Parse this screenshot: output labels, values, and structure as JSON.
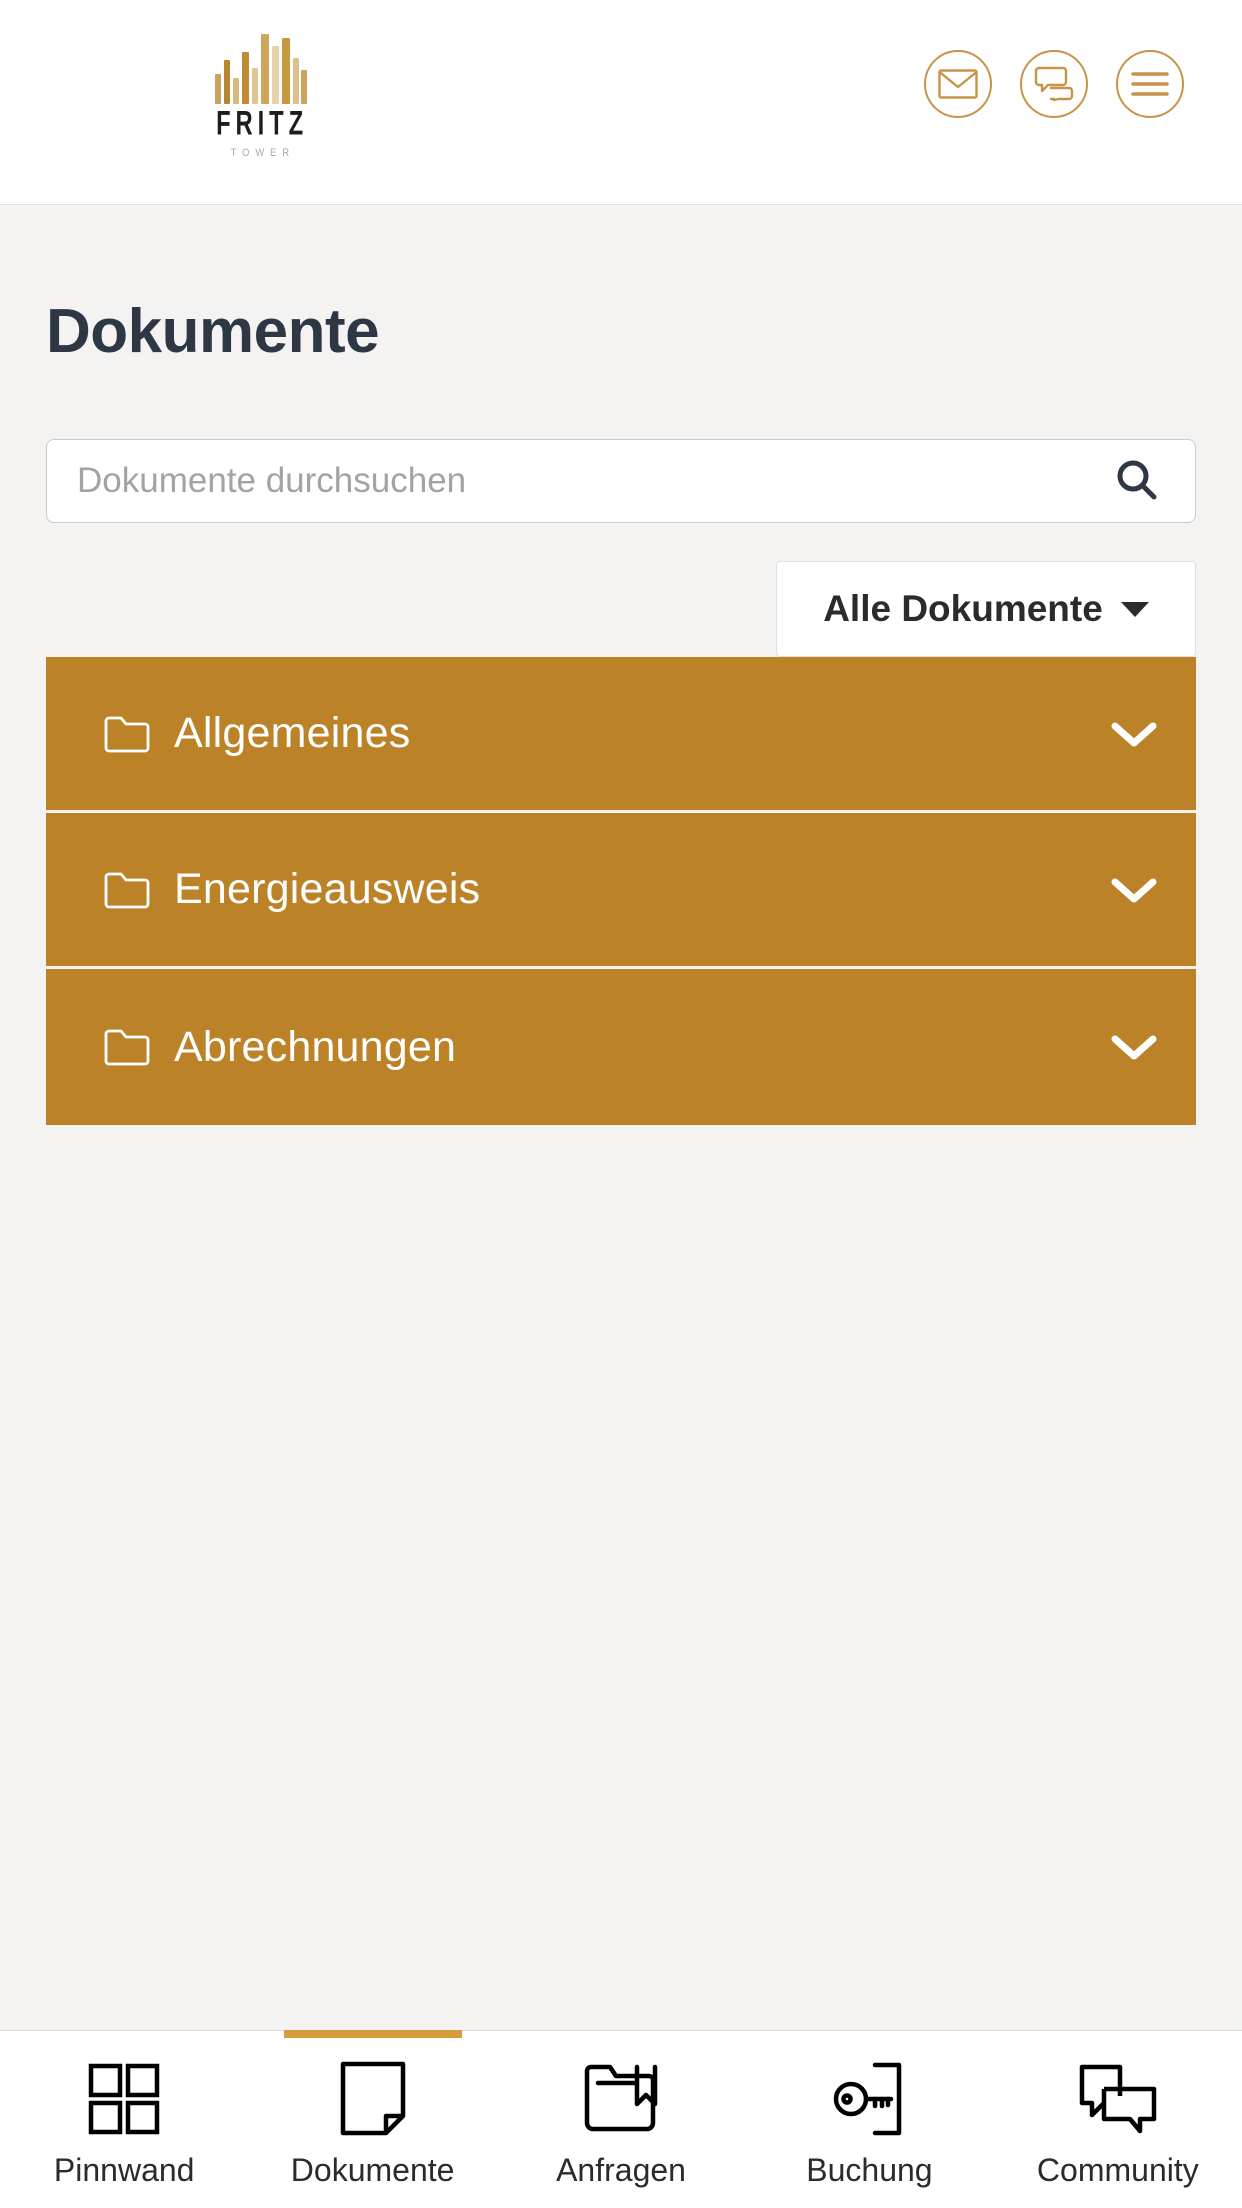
{
  "brand": {
    "name": "FRITZ",
    "subtitle": "TOWER",
    "mark_icon": "tower-skyline-logo",
    "mark_color": "#c89348"
  },
  "header": {
    "actions": [
      {
        "id": "mail",
        "icon": "mail-icon",
        "label": "Nachrichten"
      },
      {
        "id": "chat",
        "icon": "chat-bubbles-icon",
        "label": "Chat"
      },
      {
        "id": "menu",
        "icon": "hamburger-menu-icon",
        "label": "Menü"
      }
    ],
    "accent_color": "#c89348"
  },
  "main": {
    "title": "Dokumente",
    "search": {
      "placeholder": "Dokumente durchsuchen",
      "value": "",
      "icon": "search-icon"
    },
    "filter": {
      "label": "Alle Dokumente",
      "icon": "chevron-down-icon",
      "options": [
        "Alle Dokumente"
      ]
    },
    "folders": [
      {
        "label": "Allgemeines",
        "icon": "folder-icon",
        "expand_icon": "chevron-down-icon",
        "expanded": false
      },
      {
        "label": "Energieausweis",
        "icon": "folder-icon",
        "expand_icon": "chevron-down-icon",
        "expanded": false
      },
      {
        "label": "Abrechnungen",
        "icon": "folder-icon",
        "expand_icon": "chevron-down-icon",
        "expanded": false
      }
    ],
    "folder_color": "#bc8228"
  },
  "bottom_nav": {
    "active_index": 1,
    "active_color": "#d99a3c",
    "items": [
      {
        "label": "Pinnwand",
        "icon": "grid-squares-icon"
      },
      {
        "label": "Dokumente",
        "icon": "document-page-icon"
      },
      {
        "label": "Anfragen",
        "icon": "folder-bookmark-icon"
      },
      {
        "label": "Buchung",
        "icon": "key-door-icon"
      },
      {
        "label": "Community",
        "icon": "speech-bubbles-icon"
      }
    ]
  }
}
